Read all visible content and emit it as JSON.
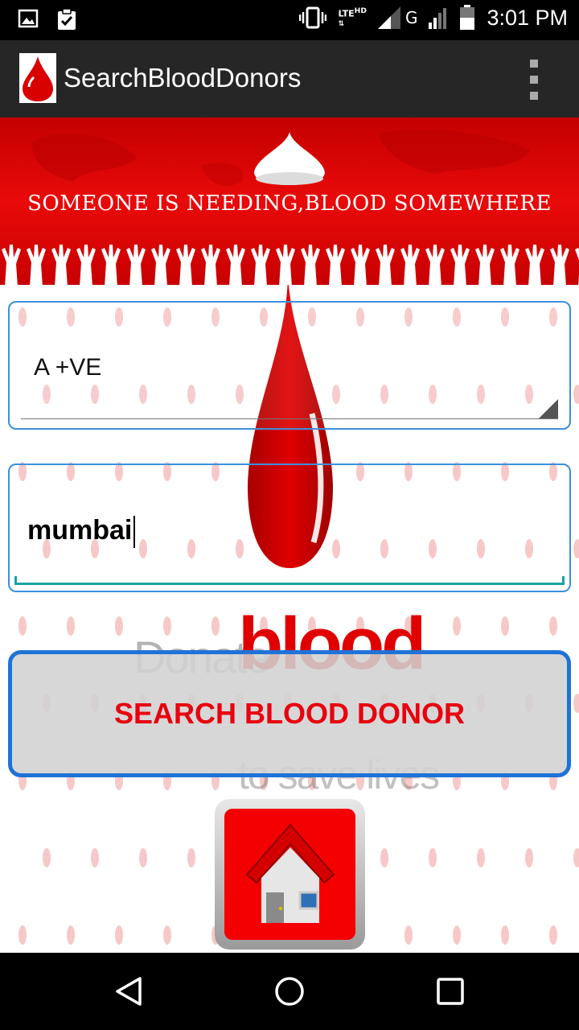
{
  "status_bar": {
    "time": "3:01 PM",
    "network_label_top": "LTE",
    "network_label_hd": "HD",
    "network_type": "G",
    "icons": [
      "gallery-icon",
      "clipboard-check-icon",
      "vibrate-icon",
      "signal-icon",
      "battery-icon"
    ]
  },
  "action_bar": {
    "title": "SearchBloodDonors",
    "app_icon": "blood-drop-icon",
    "menu_icon": "overflow-menu-icon"
  },
  "banner": {
    "text": "SOMEONE IS NEEDING,BLOOD SOMEWHERE"
  },
  "form": {
    "blood_group_value": "A +VE",
    "city_value": "mumbai",
    "search_button_label": "SEARCH BLOOD DONOR"
  },
  "background_art": {
    "word_1": "Donate",
    "word_2": "blood",
    "word_3": "to save lives"
  },
  "home_button": {
    "icon": "home-icon"
  },
  "nav_bar": {
    "icons": [
      "back-icon",
      "home-circle-icon",
      "recents-icon"
    ]
  },
  "colors": {
    "accent_red": "#e8000e",
    "border_blue": "#3d8fdd",
    "button_border_blue": "#1f73d8",
    "action_bar": "#262626",
    "underline_teal": "#1aa3a3"
  }
}
